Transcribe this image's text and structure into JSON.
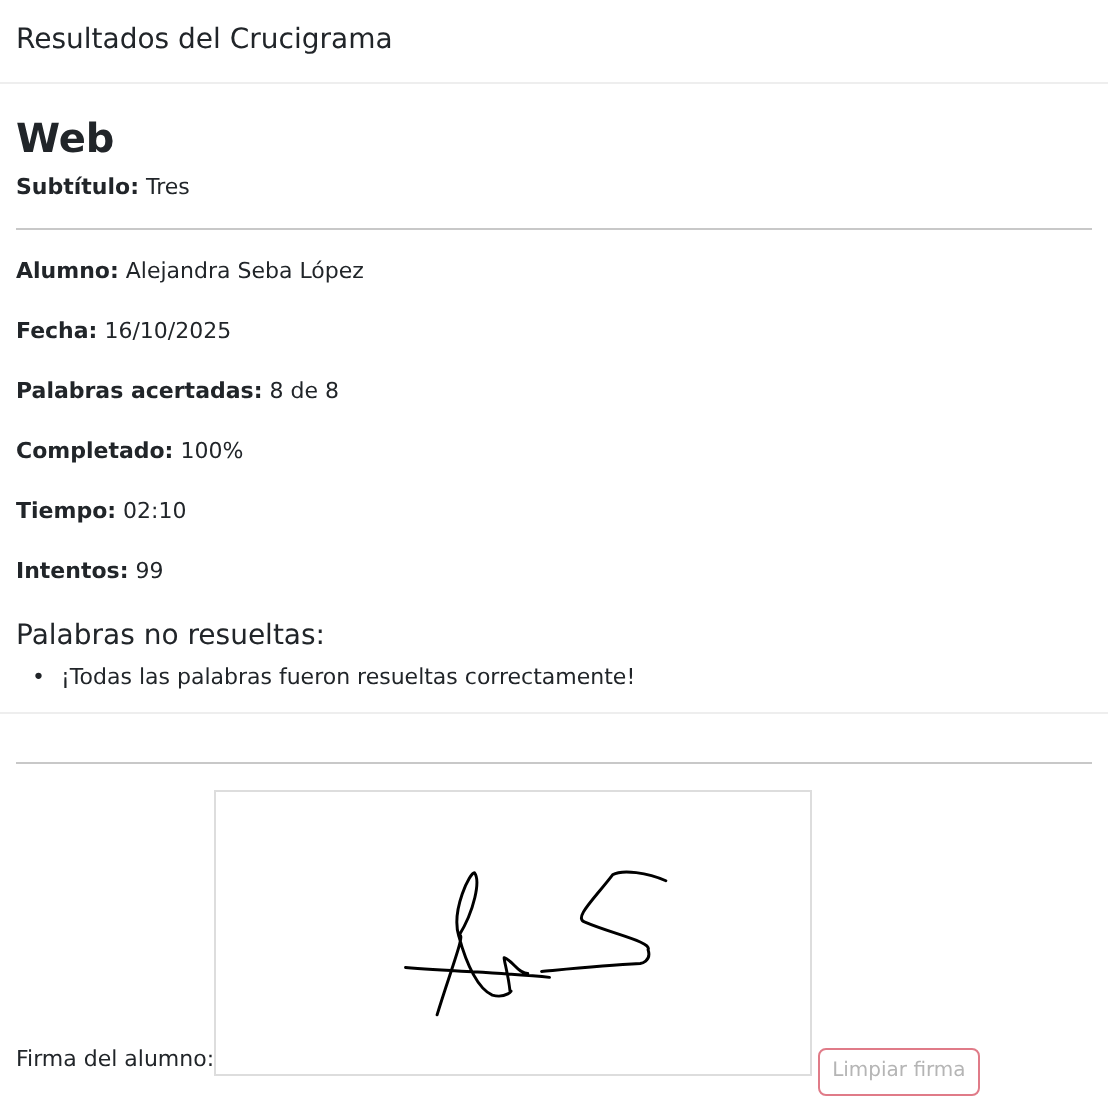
{
  "header": {
    "title": "Resultados del Crucigrama"
  },
  "title": "Web",
  "subtitle": {
    "label": "Subtítulo:",
    "value": "Tres"
  },
  "fields": [
    {
      "label": "Alumno:",
      "value": "Alejandra Seba López"
    },
    {
      "label": "Fecha:",
      "value": "16/10/2025"
    },
    {
      "label": "Palabras acertadas:",
      "value": "8 de 8"
    },
    {
      "label": "Completado:",
      "value": "100%"
    },
    {
      "label": "Tiempo:",
      "value": "02:10"
    },
    {
      "label": "Intentos:",
      "value": "99"
    }
  ],
  "unsolved": {
    "heading": "Palabras no resueltas:",
    "items": [
      {
        "marker": "•",
        "text": "¡Todas las palabras fueron resueltas correctamente!"
      }
    ]
  },
  "signature": {
    "label": "Firma del alumno:",
    "clear_button": {
      "label": "Limpiar firma",
      "disabled": true
    }
  }
}
